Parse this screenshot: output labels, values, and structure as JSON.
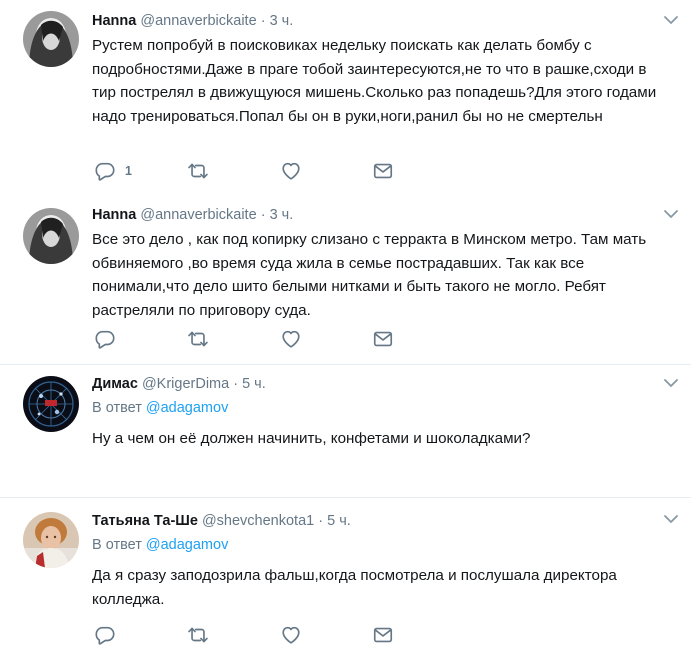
{
  "tweets": [
    {
      "name": "Hanna",
      "handle": "@annaverbickaite",
      "separator": "·",
      "time": "3 ч.",
      "text": "Рустем попробуй в поисковиках недельку поискать как делать бомбу с подробностями.Даже в праге тобой заинтересуются,не то что в рашке,сходи в тир пострелял в движущуюся мишень.Сколько раз попадешь?Для этого годами надо тренироваться.Попал бы он в руки,ноги,ранил бы но не смертельн",
      "reply_count": "1"
    },
    {
      "name": "Hanna",
      "handle": "@annaverbickaite",
      "separator": "·",
      "time": "3 ч.",
      "text": "Все это дело , как под копирку слизано с терракта в Минском метро. Там мать обвиняемого ,во время суда жила в семье пострадавших. Так как все понимали,что дело шито белыми нитками и быть такого не могло. Ребят растреляли по приговору суда."
    },
    {
      "name": "Димас",
      "handle": "@KrigerDima",
      "separator": "·",
      "time": "5 ч.",
      "reply_prefix": "В ответ",
      "reply_to": "@adagamov",
      "text": "Ну а чем он её должен начинить, конфетами и шоколадками?"
    },
    {
      "name": "Татьяна Та-Ше",
      "handle": "@shevchenkota1",
      "separator": "·",
      "time": "5 ч.",
      "reply_prefix": "В ответ",
      "reply_to": "@adagamov",
      "text": "Да я сразу заподозрила фальш,когда посмотрела и послушала директора колледжа."
    }
  ],
  "colors": {
    "text": "#14171a",
    "secondary": "#657786",
    "link": "#1da1f2",
    "divider": "#e6ecf0"
  },
  "icons": [
    "reply-icon",
    "retweet-icon",
    "like-icon",
    "message-icon",
    "chevron-down-icon"
  ]
}
